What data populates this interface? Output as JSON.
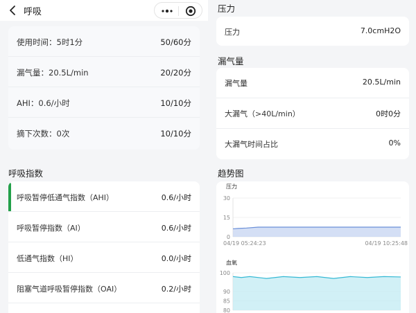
{
  "left": {
    "header": {
      "title": "呼吸"
    },
    "scores": [
      {
        "label": "使用时间：5时1分",
        "value": "50/60分"
      },
      {
        "label": "漏气量：20.5L/min",
        "value": "20/20分"
      },
      {
        "label": "AHI：0.6/小时",
        "value": "10/10分"
      },
      {
        "label": "摘下次数：0次",
        "value": "10/10分"
      }
    ],
    "breath_index_title": "呼吸指数",
    "indices": [
      {
        "label": "呼吸暂停低通气指数（AHI）",
        "value": "0.6/小时"
      },
      {
        "label": "呼吸暂停指数（AI）",
        "value": "0.6/小时"
      },
      {
        "label": "低通气指数（HI）",
        "value": "0.0/小时"
      },
      {
        "label": "阻塞气道呼吸暂停指数（OAI）",
        "value": "0.2/小时"
      }
    ],
    "colors": {
      "accent": "#23a04a"
    }
  },
  "right": {
    "pressure_title": "压力",
    "pressure_rows": [
      {
        "label": "压力",
        "value": "7.0cmH2O"
      }
    ],
    "leak_title": "漏气量",
    "leak_rows": [
      {
        "label": "漏气量",
        "value": "20.5L/min"
      },
      {
        "label": "大漏气（>40L/min）",
        "value": "0时0分"
      },
      {
        "label": "大漏气时间占比",
        "value": "0%"
      }
    ],
    "trend_title": "趋势图"
  },
  "chart_data": [
    {
      "type": "area",
      "title": "压力",
      "ylim": [
        0,
        30
      ],
      "y_ticks": [
        "30",
        "15",
        "0"
      ],
      "x_start_label": "04/19 05:24:23",
      "x_end_label": "04/19 10:25:48",
      "x": [
        0,
        0.03,
        0.08,
        0.15,
        1.0
      ],
      "values": [
        6.2,
        6.5,
        6.8,
        7.5,
        7.5
      ],
      "colors": {
        "line": "#6a8fd8",
        "fill": "#c9d7f3"
      }
    },
    {
      "type": "area",
      "title": "血氧",
      "ylim": [
        80,
        100
      ],
      "y_ticks": [
        "100",
        "90",
        "85",
        "80"
      ],
      "x": [
        0,
        0.05,
        0.1,
        0.2,
        0.3,
        0.4,
        0.5,
        0.6,
        0.7,
        0.8,
        0.9,
        1.0
      ],
      "values": [
        98,
        97.5,
        98,
        97,
        98,
        97.5,
        98,
        97,
        98,
        97.5,
        98,
        97.8
      ],
      "colors": {
        "line": "#35b9d4",
        "fill": "#c6ecf4"
      }
    }
  ]
}
